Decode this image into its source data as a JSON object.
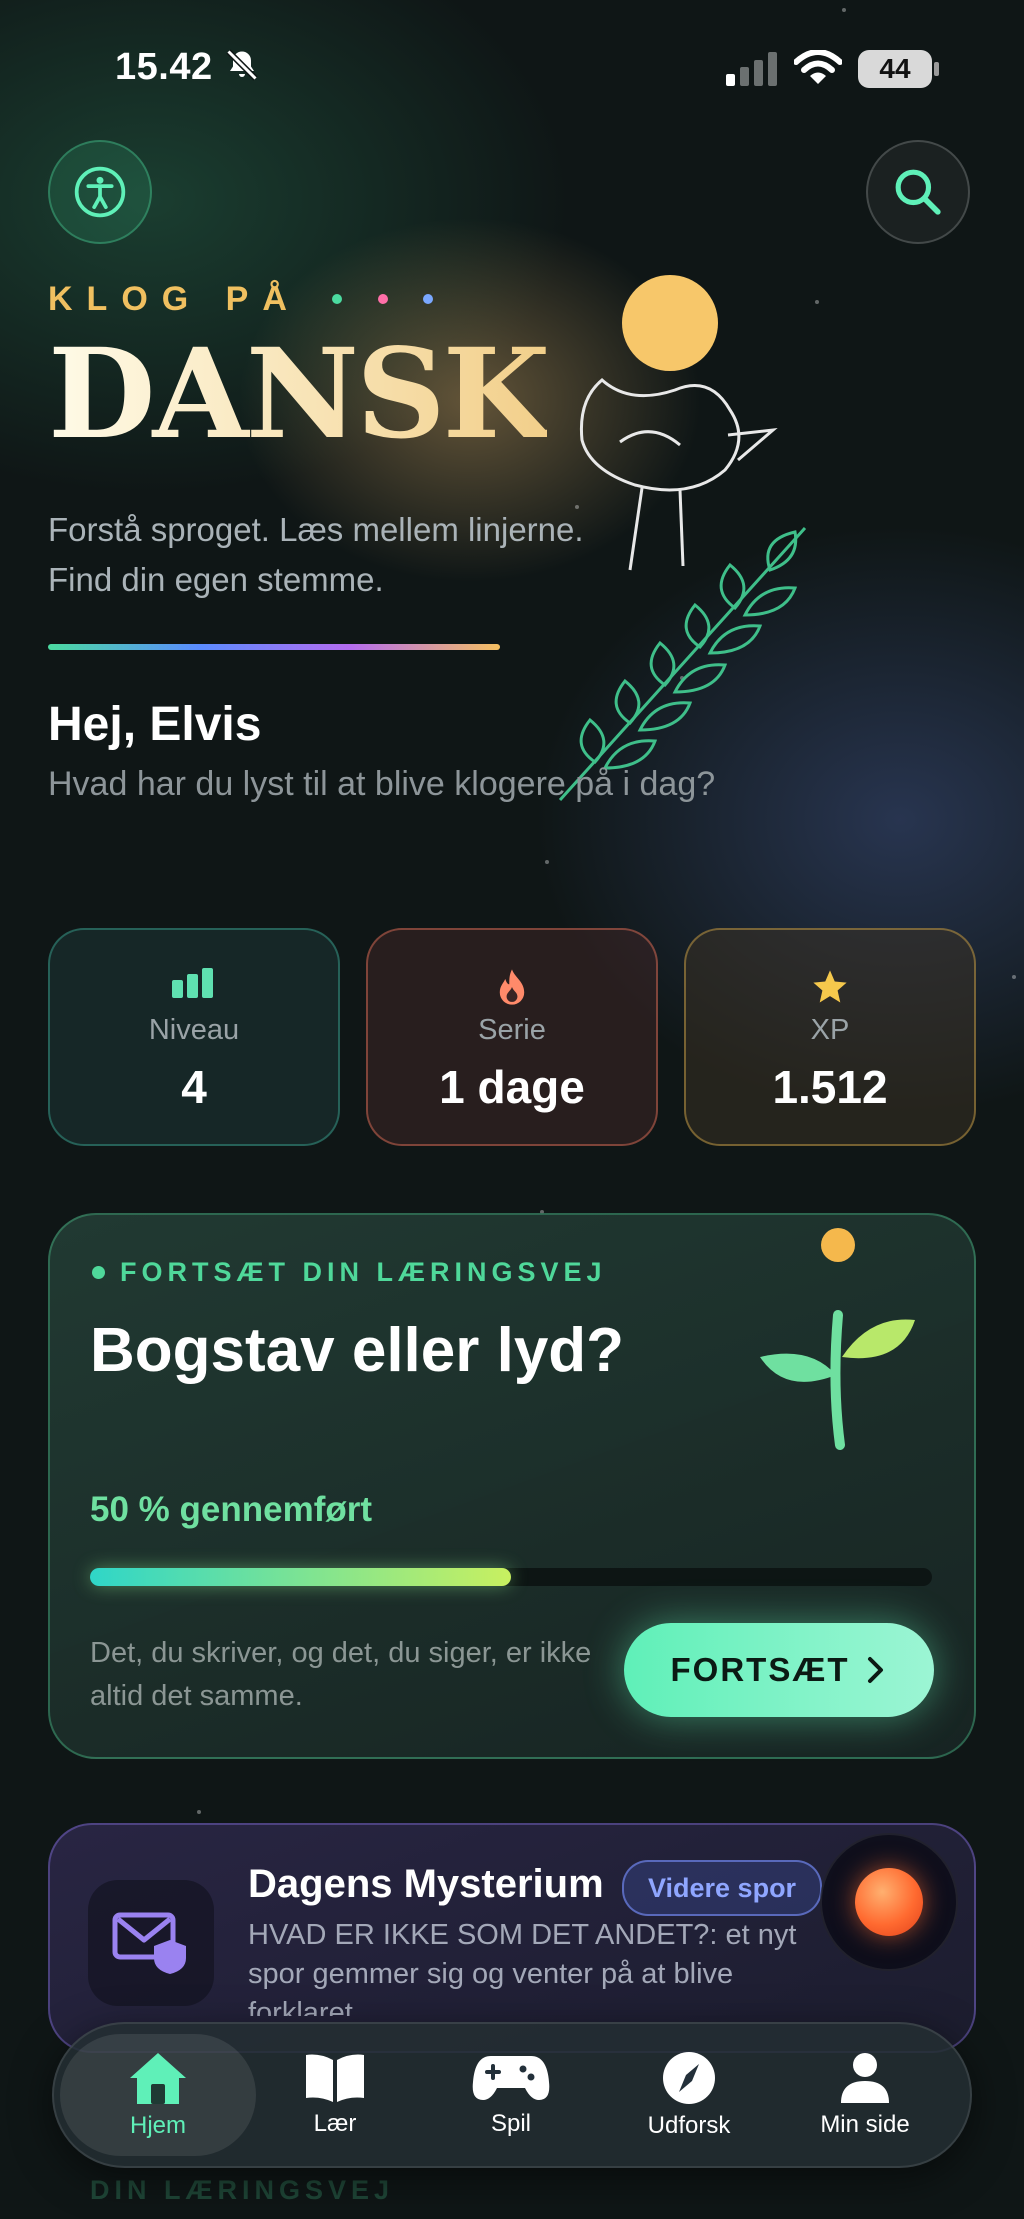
{
  "status_bar": {
    "time": "15.42",
    "battery": "44"
  },
  "header": {
    "eyebrow": "KLOG PÅ",
    "title": "DANSK",
    "tagline_line1": "Forstå sproget. Læs mellem linjerne.",
    "tagline_line2": "Find din egen stemme.",
    "greeting": "Hej, Elvis",
    "subgreeting": "Hvad har du lyst til at blive klogere på i dag?"
  },
  "stats": [
    {
      "label": "Niveau",
      "value": "4",
      "icon": "bar-chart-icon",
      "color": "#5fe0b0"
    },
    {
      "label": "Serie",
      "value": "1 dage",
      "icon": "flame-icon",
      "color": "#ff8a6a"
    },
    {
      "label": "XP",
      "value": "1.512",
      "icon": "star-icon",
      "color": "#f5c84c"
    }
  ],
  "continue_card": {
    "eyebrow": "FORTSÆT DIN LÆRINGSVEJ",
    "title": "Bogstav eller lyd?",
    "progress_label": "50 % gennemført",
    "progress": 0.5,
    "description": "Det, du skriver, og det, du siger, er ikke altid det samme.",
    "button": "FORTSÆT"
  },
  "mystery_card": {
    "title": "Dagens Mysterium",
    "badge": "Videre spor",
    "text": "HVAD ER IKKE SOM DET ANDET?: et nyt spor gemmer sig og venter på at blive forklaret"
  },
  "ghost_label": "DIN LÆRINGSVEJ",
  "nav": [
    {
      "label": "Hjem",
      "icon": "home-icon",
      "active": true
    },
    {
      "label": "Lær",
      "icon": "book-icon"
    },
    {
      "label": "Spil",
      "icon": "gamepad-icon"
    },
    {
      "label": "Udforsk",
      "icon": "compass-icon"
    },
    {
      "label": "Min side",
      "icon": "person-icon"
    }
  ],
  "colors": {
    "accent": "#5ff0b8",
    "gold": "#f0c060",
    "background": "#0f1616"
  }
}
